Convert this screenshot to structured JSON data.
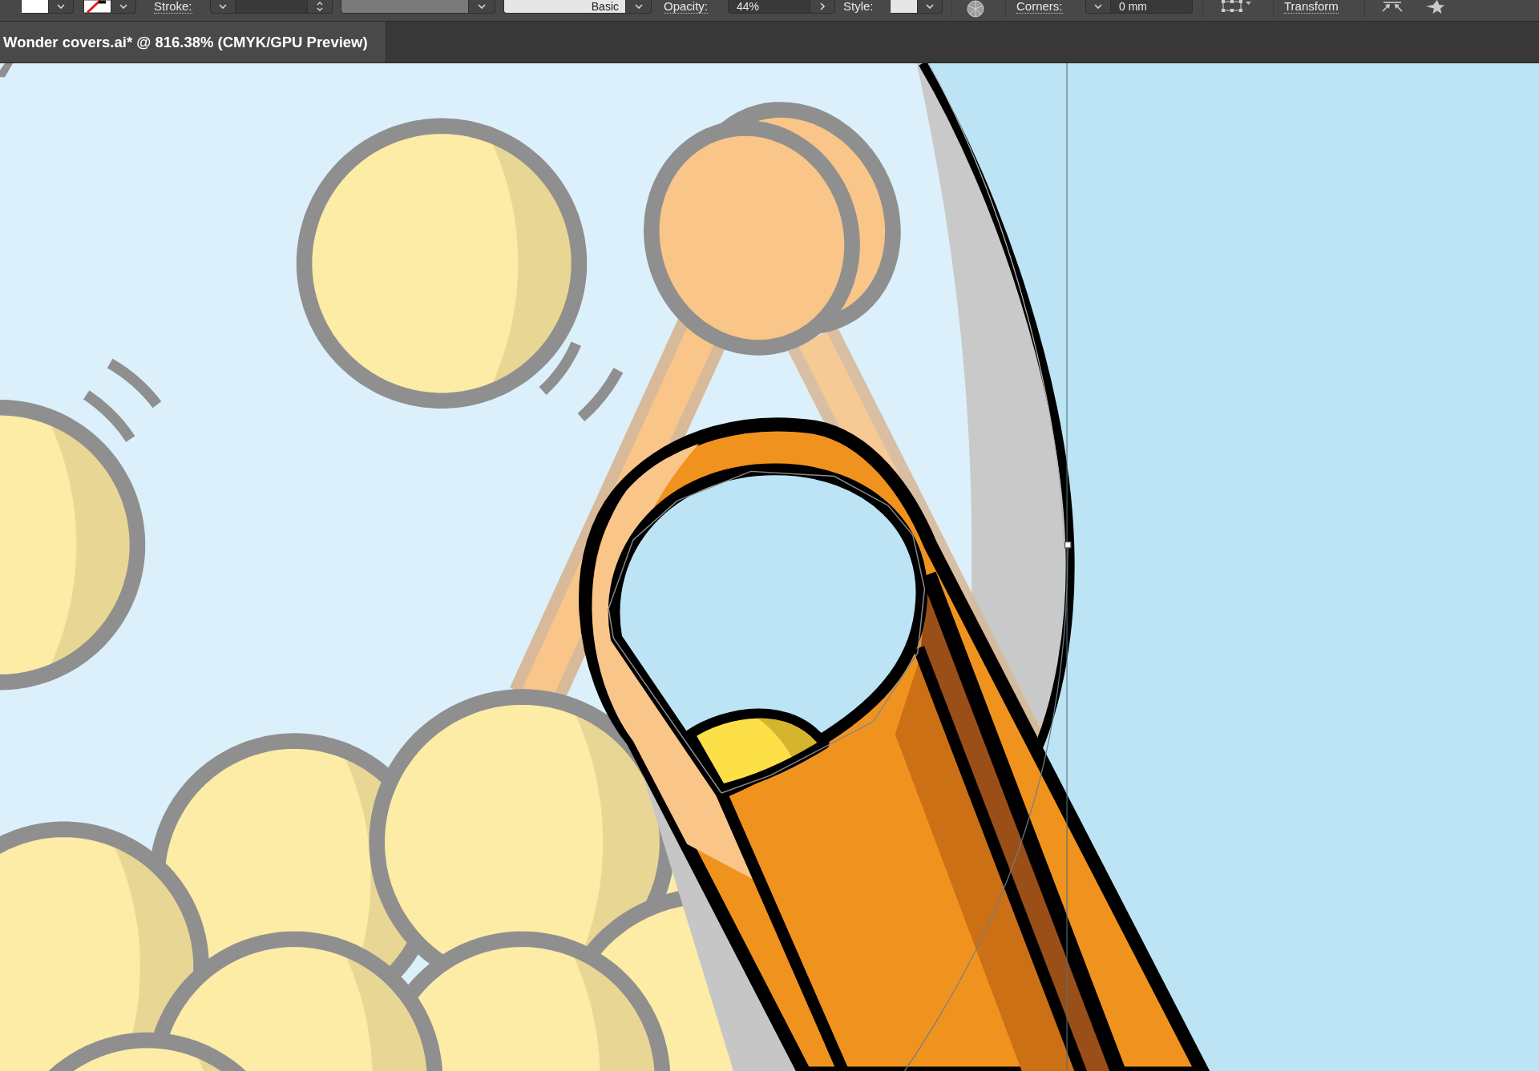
{
  "control_bar": {
    "fill_swatch": {
      "color": "#ffffff"
    },
    "stroke_swatch": {
      "none": true
    },
    "stroke_label": "Stroke:",
    "brush": "Basic",
    "opacity_label": "Opacity:",
    "opacity": "44%",
    "style_label": "Style:",
    "corners_label": "Corners:",
    "corners": "0 mm",
    "transform_label": "Transform"
  },
  "document_tabs": [
    {
      "title": "Wonder covers.ai* @ 816.38% (CMYK/GPU Preview)",
      "selected": true
    }
  ]
}
